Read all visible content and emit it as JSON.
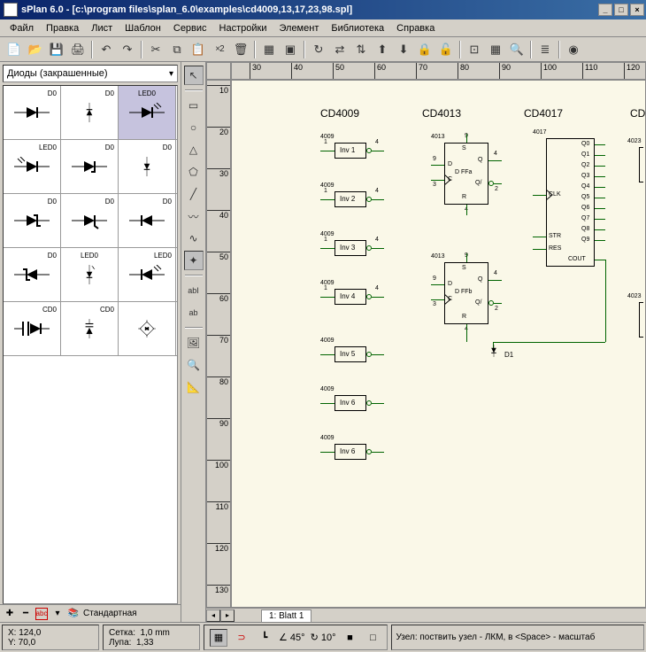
{
  "title": "sPlan 6.0 - [c:\\program files\\splan_6.0\\examples\\cd4009,13,17,23,98.spl]",
  "menubar": [
    "Файл",
    "Правка",
    "Лист",
    "Шаблон",
    "Сервис",
    "Настройки",
    "Элемент",
    "Библиотека",
    "Справка"
  ],
  "library_dropdown": "Диоды (закрашенные)",
  "library_cells": [
    [
      "D0",
      "D0",
      "LED0"
    ],
    [
      "LED0",
      "D0",
      "D0"
    ],
    [
      "D0",
      "D0",
      "D0"
    ],
    [
      "D0",
      "LED0",
      "LED0"
    ],
    [
      "CD0",
      "CD0",
      ""
    ]
  ],
  "lib_bottom_label": "Стандартная",
  "ruler_h": [
    "30",
    "40",
    "50",
    "60",
    "70",
    "80",
    "90",
    "100",
    "110",
    "120"
  ],
  "ruler_v": [
    "10",
    "20",
    "30",
    "40",
    "50",
    "60",
    "70",
    "80",
    "90",
    "100",
    "110",
    "120",
    "130"
  ],
  "chips": {
    "cd4009": "CD4009",
    "cd4013": "CD4013",
    "cd4017": "CD4017",
    "cd_partial": "CD"
  },
  "inv_labels": [
    "Inv 1",
    "Inv 2",
    "Inv 3",
    "Inv 4",
    "Inv 5",
    "Inv 6"
  ],
  "inv_refs": [
    "4009",
    "4009",
    "4009",
    "4009",
    "4009",
    "4009"
  ],
  "ff_refs": [
    "4013",
    "4013"
  ],
  "ff_labels": {
    "s": "S",
    "d": "D",
    "c": "C",
    "r": "R",
    "q": "Q",
    "qn": "Q/",
    "type": "D FFa",
    "type_b": "D FFb"
  },
  "cd4017_ref": "4017",
  "cd4017_pins": {
    "clk": "CLK",
    "str": "STR",
    "res": "RES",
    "cout": "COUT",
    "q": [
      "Q0",
      "Q1",
      "Q2",
      "Q3",
      "Q4",
      "Q5",
      "Q6",
      "Q7",
      "Q8",
      "Q9"
    ]
  },
  "cd4023_refs": [
    "4023",
    "4023"
  ],
  "diode_label": "D1",
  "sheet_tab": "1: Blatt 1",
  "status": {
    "coords": "X: 124,0\nY: 70,0",
    "grid": "Сетка:  1,0 mm\nЛупа:  1,33",
    "angle1": "45°",
    "angle2": "10°",
    "hint": "Узел: поствить узел - ЛКМ, в\n<Space> - масштаб"
  },
  "window_buttons": {
    "min": "_",
    "max": "□",
    "close": "×"
  }
}
